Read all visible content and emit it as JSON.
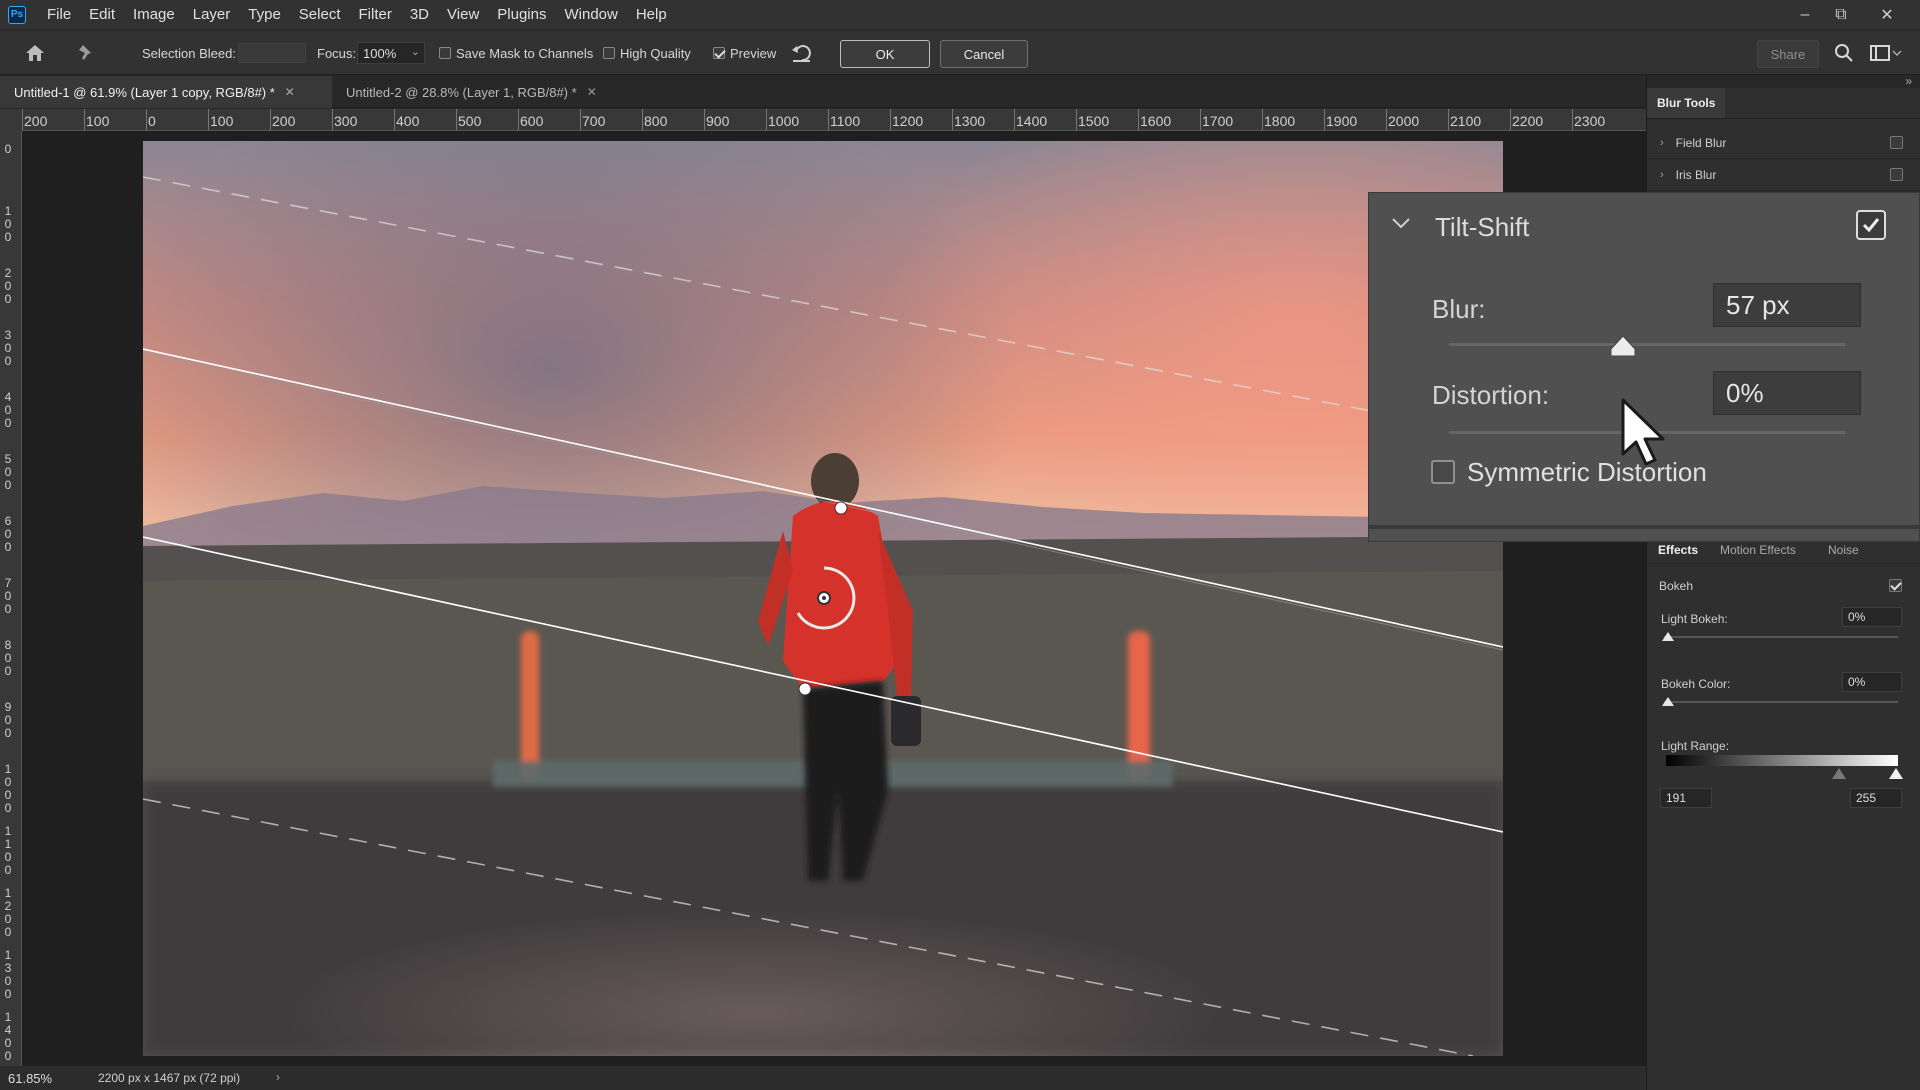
{
  "app": {
    "logo_text": "Ps"
  },
  "menu": [
    "File",
    "Edit",
    "Image",
    "Layer",
    "Type",
    "Select",
    "Filter",
    "3D",
    "View",
    "Plugins",
    "Window",
    "Help"
  ],
  "window_controls": {
    "minimize": "–",
    "restore": "⧉",
    "close": "✕"
  },
  "options": {
    "selection_bleed_label": "Selection Bleed:",
    "focus_label": "Focus:",
    "focus_value": "100%",
    "save_mask_label": "Save Mask to Channels",
    "high_quality_label": "High Quality",
    "preview_label": "Preview",
    "preview_checked": true,
    "ok_label": "OK",
    "cancel_label": "Cancel",
    "share_label": "Share"
  },
  "tabs": [
    {
      "label": "Untitled-1 @ 61.9% (Layer 1 copy, RGB/8#) *",
      "active": true
    },
    {
      "label": "Untitled-2 @ 28.8% (Layer 1, RGB/8#) *",
      "active": false
    }
  ],
  "ruler_h": [
    "200",
    "100",
    "0",
    "100",
    "200",
    "300",
    "400",
    "500",
    "600",
    "700",
    "800",
    "900",
    "1000",
    "1100",
    "1200",
    "1300",
    "1400",
    "1500",
    "1600",
    "1700",
    "1800",
    "1900",
    "2000",
    "2100",
    "2200",
    "2300"
  ],
  "ruler_v": [
    "0",
    "100",
    "200",
    "300",
    "400",
    "500",
    "600",
    "700",
    "800",
    "900",
    "1000",
    "1100",
    "1200",
    "1300",
    "1400"
  ],
  "status": {
    "zoom": "61.85%",
    "doc_info": "2200 px x 1467 px (72 ppi)",
    "arrow": "›"
  },
  "blur_tools": {
    "panel_title": "Blur Tools",
    "field_blur": "Field Blur",
    "iris_blur": "Iris Blur",
    "tilt_shift": {
      "title": "Tilt-Shift",
      "enabled": true,
      "blur_label": "Blur:",
      "blur_value": "57 px",
      "blur_level": 0.44,
      "distortion_label": "Distortion:",
      "distortion_value": "0%",
      "distortion_level": 0.5,
      "symmetric_label": "Symmetric Distortion",
      "symmetric_checked": false
    }
  },
  "effects": {
    "tabs": [
      "Effects",
      "Motion Effects",
      "Noise"
    ],
    "bokeh_label": "Bokeh",
    "bokeh_checked": true,
    "light_bokeh_label": "Light Bokeh:",
    "light_bokeh_value": "0%",
    "bokeh_color_label": "Bokeh Color:",
    "bokeh_color_value": "0%",
    "light_range_label": "Light Range:",
    "light_range_low": "191",
    "light_range_high": "255"
  },
  "colors": {
    "accent": "#31a8ff",
    "panel": "#2f2f2f",
    "popup": "#505050"
  }
}
